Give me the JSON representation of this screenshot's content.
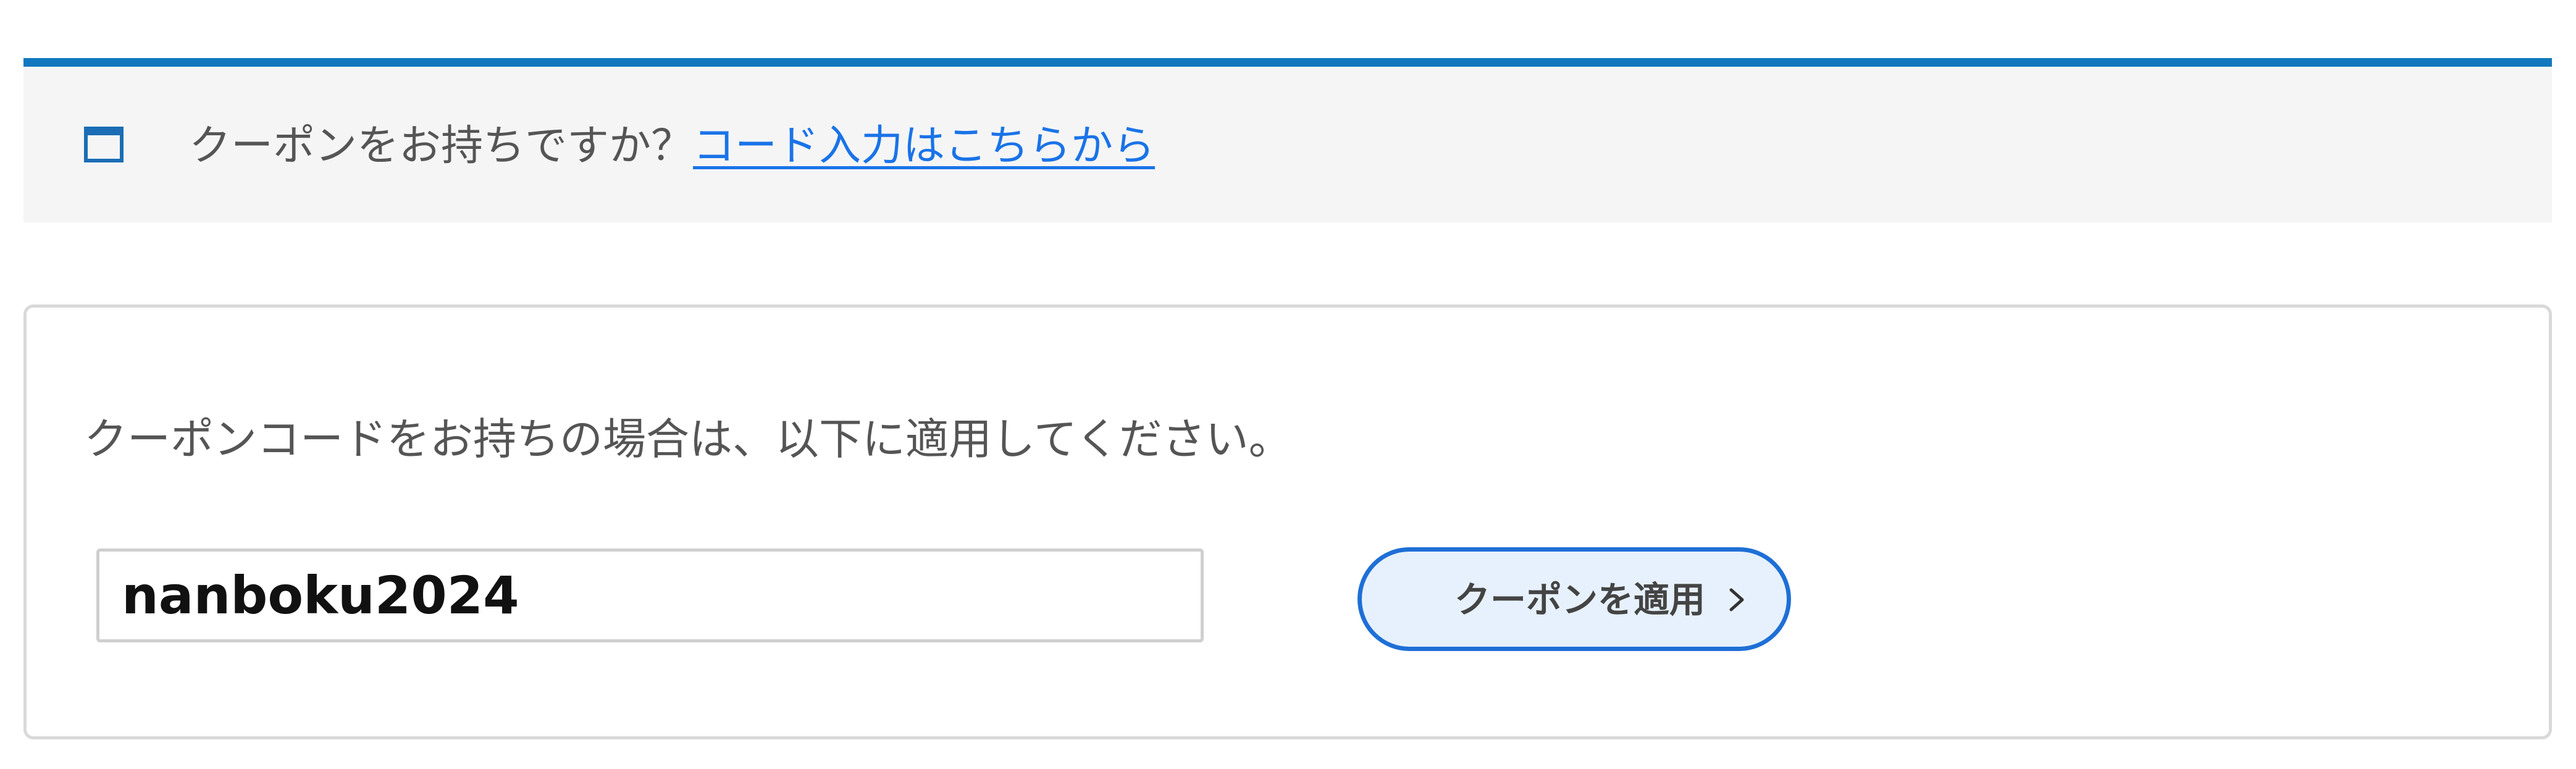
{
  "notice": {
    "icon": "window-icon",
    "question": "クーポンをお持ちですか？",
    "link_label": "コード入力はこちらから",
    "accent_color": "#1178bf"
  },
  "coupon": {
    "instruction": "クーポンコードをお持ちの場合は、以下に適用してください。",
    "input_value": "nanboku2024",
    "apply_button_label": "クーポンを適用",
    "apply_button_icon": "chevron-right-icon",
    "button_border_color": "#1e6fd6",
    "button_fill_color": "#e7f1fd"
  }
}
